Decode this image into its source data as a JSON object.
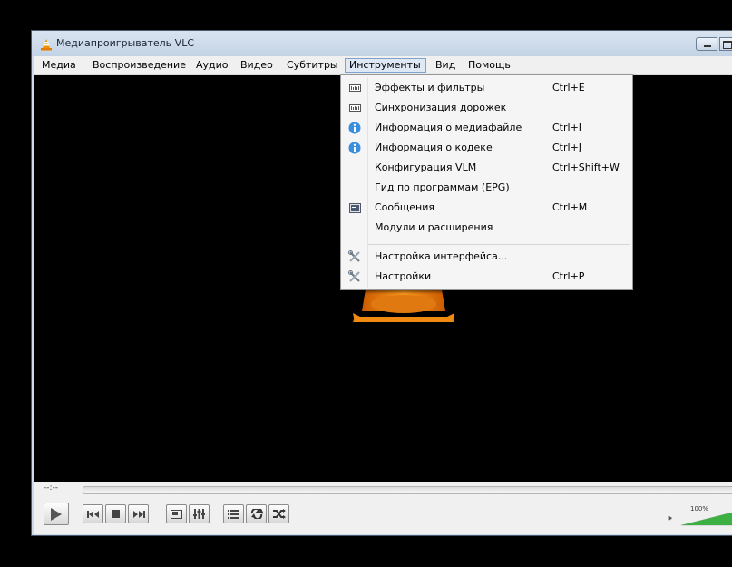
{
  "window": {
    "title": "Медиапроигрыватель VLC"
  },
  "menubar": {
    "items": [
      "Медиа",
      "Воспроизведение",
      "Аудио",
      "Видео",
      "Субтитры",
      "Инструменты",
      "Вид",
      "Помощь"
    ],
    "active": "Инструменты"
  },
  "tools_menu": {
    "items": [
      {
        "label": "Эффекты и фильтры",
        "shortcut": "Ctrl+E",
        "icon": "equalizer-icon"
      },
      {
        "label": "Синхронизация дорожек",
        "shortcut": "",
        "icon": "equalizer-icon"
      },
      {
        "label": "Информация о медиафайле",
        "shortcut": "Ctrl+I",
        "icon": "info-icon"
      },
      {
        "label": "Информация о кодеке",
        "shortcut": "Ctrl+J",
        "icon": "info-icon"
      },
      {
        "label": "Конфигурация VLM",
        "shortcut": "Ctrl+Shift+W",
        "icon": ""
      },
      {
        "label": "Гид по программам (EPG)",
        "shortcut": "",
        "icon": ""
      },
      {
        "label": "Сообщения",
        "shortcut": "Ctrl+M",
        "icon": "terminal-icon"
      },
      {
        "label": "Модули и расширения",
        "shortcut": "",
        "icon": ""
      },
      {
        "label": "Настройка интерфейса...",
        "shortcut": "",
        "icon": "tools-icon"
      },
      {
        "label": "Настройки",
        "shortcut": "Ctrl+P",
        "icon": "tools-icon"
      }
    ]
  },
  "controls": {
    "time": "--:--",
    "volume_percent": "100%",
    "volume_level": 1.0
  },
  "colors": {
    "accent": "#ff8800",
    "volume_green": "#3cb043"
  }
}
